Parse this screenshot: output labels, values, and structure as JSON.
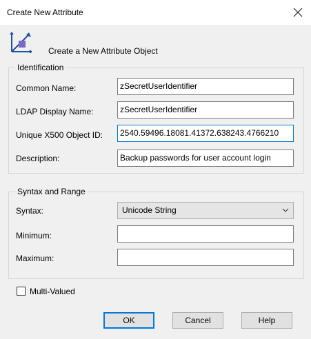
{
  "window": {
    "title": "Create New Attribute",
    "close_glyph": "✕"
  },
  "header": {
    "icon": "attribute-object-icon",
    "text": "Create a New Attribute Object"
  },
  "identification": {
    "legend": "Identification",
    "common_name": {
      "label": "Common Name:",
      "value": "zSecretUserIdentifier"
    },
    "ldap_display_name": {
      "label": "LDAP Display Name:",
      "value": "zSecretUserIdentifier"
    },
    "object_id": {
      "label": "Unique X500 Object ID:",
      "value": "2540.59496.18081.41372.638243.4766210"
    },
    "description": {
      "label": "Description:",
      "value": "Backup passwords for user account login"
    }
  },
  "syntax_range": {
    "legend": "Syntax and Range",
    "syntax": {
      "label": "Syntax:",
      "selected": "Unicode String",
      "chevron": "⌵"
    },
    "minimum": {
      "label": "Minimum:",
      "value": ""
    },
    "maximum": {
      "label": "Maximum:",
      "value": ""
    }
  },
  "multi_valued": {
    "label": "Multi-Valued",
    "checked": false
  },
  "buttons": {
    "ok": "OK",
    "cancel": "Cancel",
    "help": "Help"
  },
  "colors": {
    "focus_border": "#0078d7",
    "icon_blue": "#1f4fa0",
    "icon_purple": "#7b68c8"
  }
}
